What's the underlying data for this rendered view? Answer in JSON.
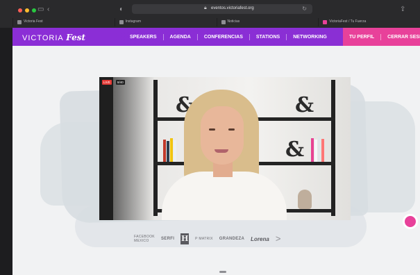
{
  "browser": {
    "url": "eventos.victoriafest.org",
    "tabs": [
      {
        "label": "Victoria Fest"
      },
      {
        "label": "Instagram"
      },
      {
        "label": "Noticias"
      },
      {
        "label": "VictoriaFest / Tu Fuerza"
      }
    ]
  },
  "site": {
    "logo_main": "VICTORIA",
    "logo_accent": "Fest",
    "nav": [
      "SPEAKERS",
      "AGENDA",
      "CONFERENCIAS",
      "STATIONS",
      "NETWORKING"
    ],
    "nav_right": [
      "TU PERFIL",
      "CERRAR SESIÓN"
    ]
  },
  "video": {
    "live_badge": "LIVE",
    "viewer_count": "8/40"
  },
  "sponsors": {
    "items": [
      "FACEBOOK MEXICO",
      "SERFI",
      "H",
      "P MATRIX",
      "GRANDEZA",
      "Lorena"
    ],
    "next_glyph": ">"
  },
  "colors": {
    "nav_purple": "#8b2ed6",
    "nav_pink": "#e8419a",
    "page_bg": "#f1f2f3"
  }
}
